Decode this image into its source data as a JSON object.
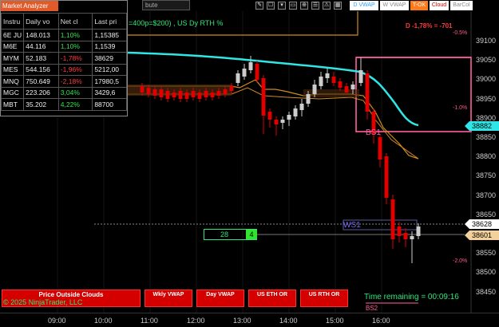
{
  "toolbar": {
    "instrument_partial": "bute",
    "buttons": [
      {
        "label": "D VWAP",
        "bg": "#ffffff",
        "fg": "#2ea3ff"
      },
      {
        "label": "W VWAP",
        "bg": "#ffffff",
        "fg": "#8a8a8a"
      },
      {
        "label": "T-OK",
        "bg": "#ff7a1a",
        "fg": "#ffffff"
      },
      {
        "label": "Cloud",
        "bg": "#ffffff",
        "fg": "#d40000"
      },
      {
        "label": "BarCol",
        "bg": "#ffffff",
        "fg": "#8a8a8a"
      }
    ]
  },
  "chart": {
    "title_partial": "=400p=$200) , US Dy RTH %",
    "d_label": "D -1,78% = -701",
    "pct_labels": [
      "-0.5%",
      "-1.0%",
      "-2.0%"
    ],
    "price_labels": [
      "39100",
      "39050",
      "39000",
      "38950",
      "38900",
      "38850",
      "38800",
      "38750",
      "38700",
      "38650",
      "38600",
      "38550",
      "38500",
      "38450"
    ],
    "price_tags": [
      {
        "value": "38882",
        "bg": "#2ee6e6"
      },
      {
        "value": "38628",
        "bg": "#ffffff"
      },
      {
        "value": "38601",
        "bg": "#f4d09a"
      }
    ],
    "time_labels": [
      "09:00",
      "10:00",
      "11:00",
      "12:00",
      "13:00",
      "14:00",
      "15:00",
      "16:00"
    ],
    "zones": {
      "bs1": "BS1",
      "ws1": "WS1",
      "bs2": "BS2"
    },
    "counter": {
      "value": "28",
      "badge": "4"
    },
    "colors": {
      "vwap": "#2ee6e6",
      "orange": "#d08a20",
      "up": "#cccccc",
      "down": "#e00000",
      "zone": "#ff5fa0"
    }
  },
  "market_analyzer": {
    "title": "Market Analyzer",
    "columns": [
      "Instru",
      "Daily vo",
      "Net cl",
      "Last pri"
    ],
    "rows": [
      {
        "instrument": "6E JU",
        "volume": "148.013",
        "net_change": "1,10%",
        "last": "1,15385",
        "dir": "pos"
      },
      {
        "instrument": "M6E",
        "volume": "44.116",
        "net_change": "1,10%",
        "last": "1,1539",
        "dir": "pos"
      },
      {
        "instrument": "MYM",
        "volume": "52.183",
        "net_change": "-1,78%",
        "last": "38629",
        "dir": "neg"
      },
      {
        "instrument": "MES",
        "volume": "544.156",
        "net_change": "-1,96%",
        "last": "5212,00",
        "dir": "neg"
      },
      {
        "instrument": "MNQ",
        "volume": "750.649",
        "net_change": "-2,18%",
        "last": "17980,5",
        "dir": "neg"
      },
      {
        "instrument": "MGC",
        "volume": "223.206",
        "net_change": "3,04%",
        "last": "3429,6",
        "dir": "pos"
      },
      {
        "instrument": "MBT",
        "volume": "35.202",
        "net_change": "4,22%",
        "last": "88700",
        "dir": "pos"
      }
    ]
  },
  "bottom_buttons": [
    {
      "label": "Price Outside Clouds"
    },
    {
      "label": "Wkly VWAP"
    },
    {
      "label": "Day VWAP"
    },
    {
      "label": "US ETH OR"
    },
    {
      "label": "US RTH OR"
    }
  ],
  "footer": {
    "copyright": "© 2025 NinjaTrader, LLC",
    "time_remaining": "Time remaining = 00:09:16"
  }
}
